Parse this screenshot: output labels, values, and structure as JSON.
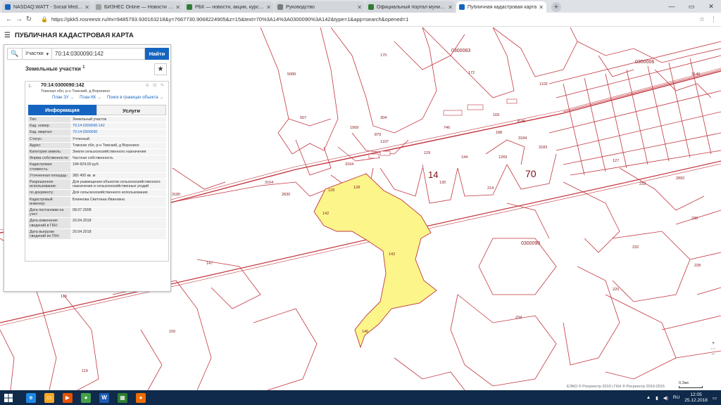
{
  "browser": {
    "tabs": [
      {
        "title": "NASDAQ:WATT - Social Media S",
        "color": "#1565c0"
      },
      {
        "title": "БИЗНЕС Online — Новости Каз",
        "color": "#9e9e9e"
      },
      {
        "title": "РБК — новости, акции, курсы в",
        "color": "#2e7d32"
      },
      {
        "title": "Руководство",
        "color": "#7a7a7a"
      },
      {
        "title": "Официальный портал муниципа",
        "color": "#2e7d32"
      },
      {
        "title": "Публичная кадастровая карта",
        "color": "#1565c0"
      }
    ],
    "new_tab": "+",
    "url": "https://pkk5.rosreestr.ru/#x=9485793.930163218&y=7667730.9068224905&z=15&text=70%3A14%3A0300090%3A142&type=1&app=search&opened=1"
  },
  "app": {
    "title": "ПУБЛИЧНАЯ КАДАСТРОВАЯ КАРТА"
  },
  "search": {
    "type_label": "Участки",
    "value": "70:14:0300090:142",
    "button_label": "Найти"
  },
  "results": {
    "section_title": "Земельные участки",
    "section_count": "1",
    "item_index": "1.",
    "cadnum": "70:14:0300090:142",
    "address": "Томская обл, р-н Томский, д Воронино",
    "links": [
      "План ЗУ →",
      "План КК →",
      "Поиск в границах объекта →"
    ],
    "tabs": [
      "Информация",
      "Услуги"
    ],
    "attrs": [
      {
        "k": "Тип:",
        "v": "Земельный участок"
      },
      {
        "k": "Кад. номер:",
        "v": "70:14:0300090:142",
        "link": true
      },
      {
        "k": "Кад. квартал:",
        "v": "70:14:0300090",
        "link": true
      },
      {
        "k": "Статус:",
        "v": "Учтенный"
      },
      {
        "k": "Адрес:",
        "v": "Томская обл, р-н Томский, д Воронино"
      },
      {
        "k": "Категория земель:",
        "v": "Земли сельскохозяйственного назначения"
      },
      {
        "k": "Форма собственности:",
        "v": "Частная собственность"
      },
      {
        "k": "Кадастровая стоимость:",
        "v": "184 824,00 руб."
      },
      {
        "k": "Уточненная площадь:",
        "v": "382 400 кв. м"
      },
      {
        "k": "Разрешенное использование:",
        "v": "Для размещения объектов сельскохозяйственного назначения и сельскохозяйственных угодий"
      },
      {
        "k": "по документу:",
        "v": "Для сельскохозяйственного использования"
      },
      {
        "k": "Кадастровый инженер:",
        "v": "Блинкова Светлана Ивановна"
      },
      {
        "k": "Дата постановки на учет:",
        "v": "08.07.2008"
      },
      {
        "k": "Дата изменения сведений в ГКН:",
        "v": "20.04.2018"
      },
      {
        "k": "Дата выгрузки сведений из ГКН:",
        "v": "20.04.2018"
      }
    ]
  },
  "map_labels": {
    "q0300083": "0300083",
    "q0300006": "0300006",
    "q0300090": "0300090",
    "q0300090b": "0300090",
    "n14": "14",
    "n70": "70",
    "p142": "142",
    "p142b": "142",
    "p170": "170",
    "p172": "172",
    "p5089": "5089",
    "p507": "507",
    "p304": "304",
    "p1069": "1069",
    "p879": "879",
    "p746": "746",
    "p1107": "1107",
    "p188": "188",
    "p3146": "3146",
    "p3184": "3184",
    "p3183": "3183",
    "p129": "129",
    "p144": "144",
    "p1269": "1269",
    "p130": "130",
    "p3164": "3164",
    "p3164b": "3164",
    "p128": "128",
    "p128b": "128",
    "p2830": "2830",
    "p3180": "3180",
    "p214": "214",
    "p127": "127",
    "p2892": "2892",
    "p233": "233",
    "p230": "230",
    "p232": "232",
    "p228": "228",
    "p220": "220",
    "p234": "234",
    "p147": "147",
    "p119": "119",
    "p119b": "119",
    "p150": "150",
    "p146": "146",
    "p1366": "1366",
    "p3140": "3140",
    "p1102": "1102",
    "p169": "169"
  },
  "attribution": "ЕЭКО © Росреестр 2010 | ГКН © Росреестр 2010-2015",
  "scale_label": "0,3км",
  "zoom": {
    "plus": "+",
    "minus": "−"
  },
  "taskbar": {
    "lang": "RU",
    "time": "12:05",
    "date": "25.12.2018",
    "apps": [
      {
        "name": "ie",
        "glyph": "e",
        "color": "#1e88e5"
      },
      {
        "name": "explorer",
        "glyph": "▭",
        "color": "#f9a825"
      },
      {
        "name": "media",
        "glyph": "▶",
        "color": "#e65100"
      },
      {
        "name": "chrome",
        "glyph": "●",
        "color": "#43a047"
      },
      {
        "name": "word",
        "glyph": "W",
        "color": "#1e5ab4"
      },
      {
        "name": "calc",
        "glyph": "▦",
        "color": "#2e7d32"
      },
      {
        "name": "app",
        "glyph": "●",
        "color": "#ef6c00"
      }
    ]
  },
  "colors": {
    "parcel_line": "#c2363f",
    "selected_fill": "#fbf58a",
    "accent": "#1565c0"
  }
}
